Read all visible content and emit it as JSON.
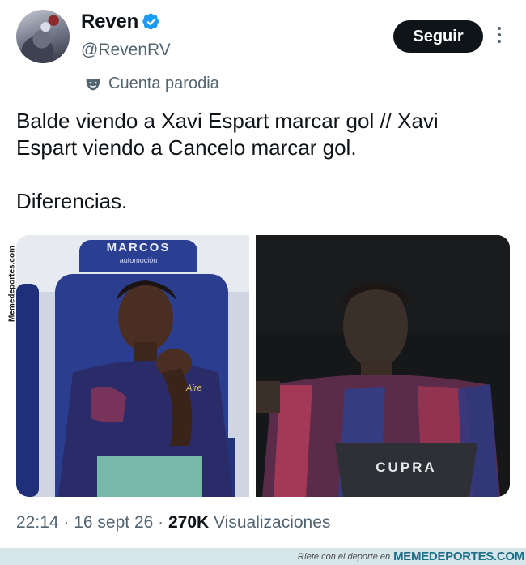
{
  "author": {
    "name": "Reven",
    "handle": "@RevenRV",
    "parody_label": "Cuenta parodia"
  },
  "actions": {
    "follow_label": "Seguir"
  },
  "tweet": {
    "text": "Balde viendo a Xavi Espart marcar gol // Xavi Espart viendo a Cancelo marcar gol.\n\nDiferencias."
  },
  "media": {
    "watermark": "Memedeportes.com",
    "left_image_signage": [
      "MARCOS",
      "automoción"
    ],
    "right_image_signage": "CUPRA"
  },
  "meta": {
    "time": "22:14",
    "date": "16 sept 26",
    "views_count": "270K",
    "views_label": "Visualizaciones"
  },
  "footer": {
    "tagline": "Ríete con el deporte en",
    "brand": "MEMEDEPORTES.COM"
  },
  "colors": {
    "verified": "#1d9bf0",
    "secondary_text": "#536471",
    "primary_text": "#0f1419",
    "footer_bg": "#d7e6ea",
    "footer_brand": "#1d6f8a"
  }
}
